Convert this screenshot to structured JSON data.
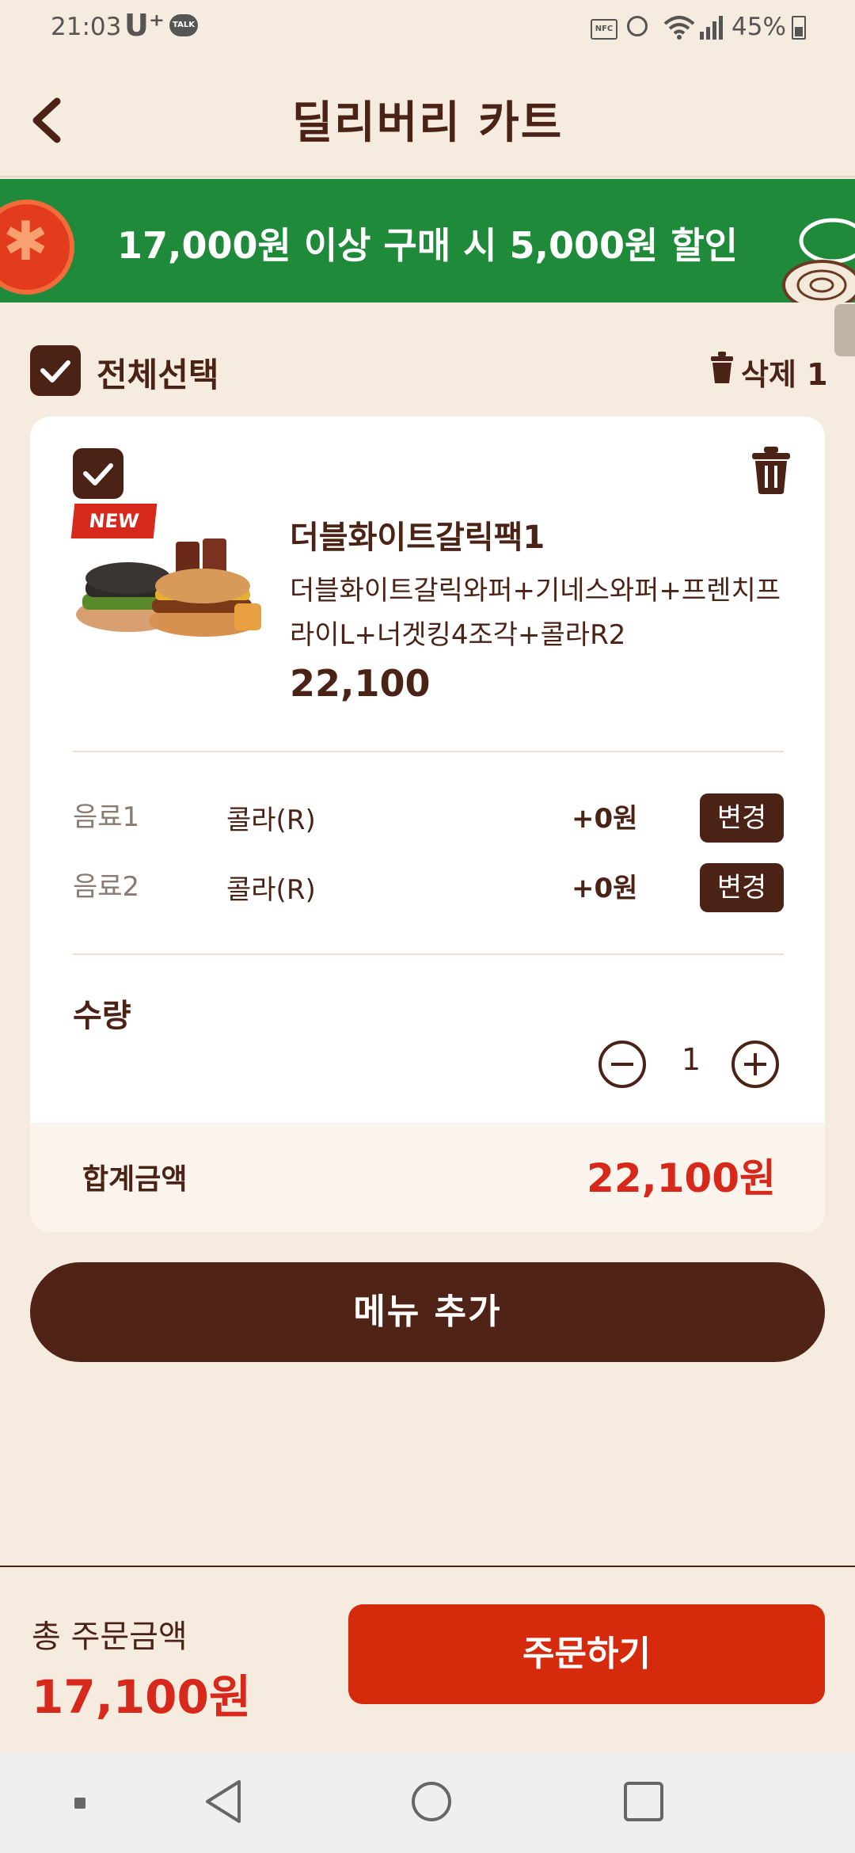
{
  "status_bar": {
    "time": "21:03",
    "carrier": "U⁺",
    "talk": "TALK",
    "nfc": "NFC",
    "battery": "45%"
  },
  "header": {
    "title": "딜리버리 카트"
  },
  "promo": {
    "text": "17,000원 이상 구매 시 5,000원 할인"
  },
  "select_all": {
    "label": "전체선택",
    "delete_label": "삭제 1"
  },
  "item": {
    "badge": "NEW",
    "name": "더블화이트갈릭팩1",
    "description": "더블화이트갈릭와퍼+기네스와퍼+프렌치프라이L+너겟킹4조각+콜라R2",
    "price": "22,100",
    "options": [
      {
        "label": "음료1",
        "value": "콜라(R)",
        "price": "+0원",
        "action": "변경"
      },
      {
        "label": "음료2",
        "value": "콜라(R)",
        "price": "+0원",
        "action": "변경"
      }
    ],
    "quantity_label": "수량",
    "quantity": "1",
    "subtotal_label": "합계금액",
    "subtotal": "22,100원"
  },
  "add_menu_label": "메뉴 추가",
  "order": {
    "total_label": "총 주문금액",
    "total_value": "17,100원",
    "button_label": "주문하기"
  },
  "colors": {
    "brown": "#4a2316",
    "red": "#d7281c",
    "green": "#1f8a3a",
    "background": "#f5ebde"
  }
}
